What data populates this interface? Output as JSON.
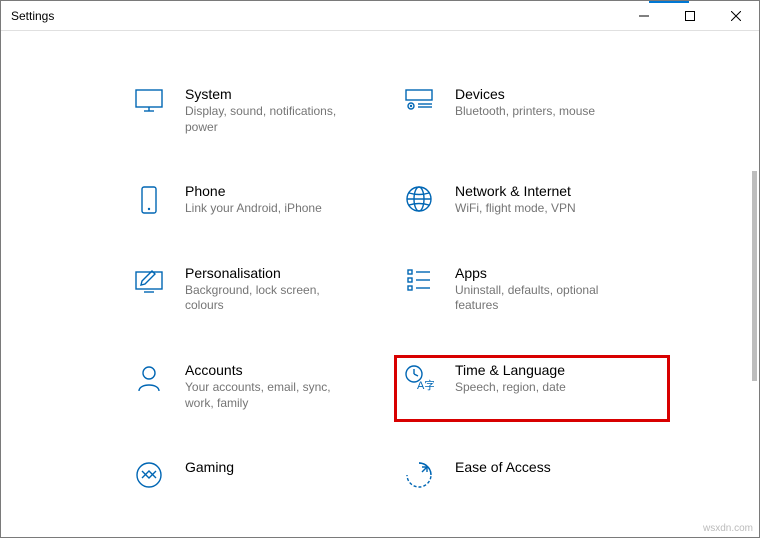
{
  "window": {
    "title": "Settings"
  },
  "items": {
    "system": {
      "title": "System",
      "sub": "Display, sound, notifications, power"
    },
    "devices": {
      "title": "Devices",
      "sub": "Bluetooth, printers, mouse"
    },
    "phone": {
      "title": "Phone",
      "sub": "Link your Android, iPhone"
    },
    "network": {
      "title": "Network & Internet",
      "sub": "WiFi, flight mode, VPN"
    },
    "personalisation": {
      "title": "Personalisation",
      "sub": "Background, lock screen, colours"
    },
    "apps": {
      "title": "Apps",
      "sub": "Uninstall, defaults, optional features"
    },
    "accounts": {
      "title": "Accounts",
      "sub": "Your accounts, email, sync, work, family"
    },
    "time": {
      "title": "Time & Language",
      "sub": "Speech, region, date"
    },
    "gaming": {
      "title": "Gaming",
      "sub": ""
    },
    "ease": {
      "title": "Ease of Access",
      "sub": ""
    }
  },
  "watermark": "wsxdn.com"
}
